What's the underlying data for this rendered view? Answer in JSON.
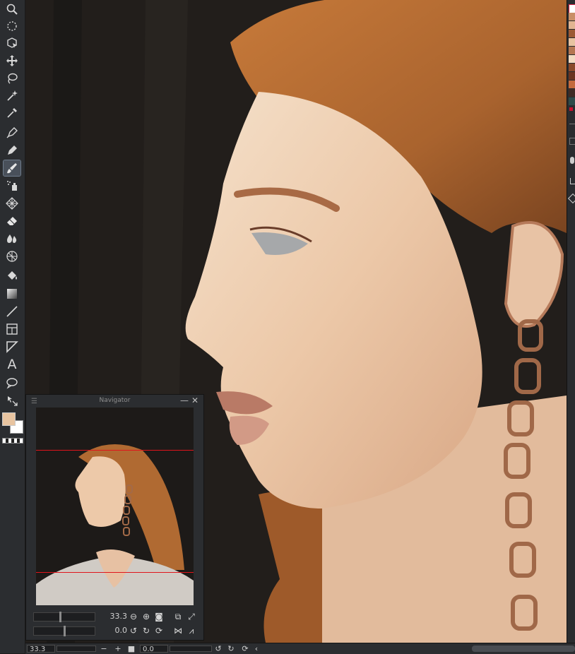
{
  "navigator": {
    "title": "Navigator",
    "zoom_value": "33.3",
    "rotation_value": "0.0"
  },
  "statusbar": {
    "zoom_value": "33.3",
    "rotation_value": "0.0"
  },
  "icons": {
    "toolbar": [
      "zoom-icon",
      "rotate-view-icon",
      "object-select-icon",
      "move-icon",
      "lasso-select-icon",
      "magic-wand-icon",
      "eyedropper-icon",
      "pen-icon",
      "pencil-icon",
      "brush-icon",
      "airbrush-icon",
      "decoration-icon",
      "eraser-icon",
      "blend-icon",
      "perspective-grid-icon",
      "fill-icon",
      "gradient-icon",
      "line-icon",
      "frame-icon",
      "ruler-icon",
      "text-icon",
      "balloon-icon",
      "correct-line-icon"
    ],
    "navigator": [
      "zoom-out-icon",
      "zoom-in-icon",
      "fit-icon",
      "actual-size-icon",
      "fullscreen-icon",
      "rotate-left-icon",
      "rotate-right-icon",
      "reset-rotation-icon",
      "flip-horizontal-icon",
      "flip-vertical-icon"
    ]
  },
  "colors": {
    "foreground": "#e8c4a0",
    "background": "#ffffff",
    "viewport_frame": "#e0141c",
    "palette": [
      "#ffffff",
      "#c98f66",
      "#e2b592",
      "#9c5a35",
      "#e8c3a1",
      "#b47652",
      "#f2dbc3",
      "#8a4a2c",
      "#6b3521",
      "#c46a3c",
      "#3f2b24",
      "#2e4b4a"
    ]
  }
}
